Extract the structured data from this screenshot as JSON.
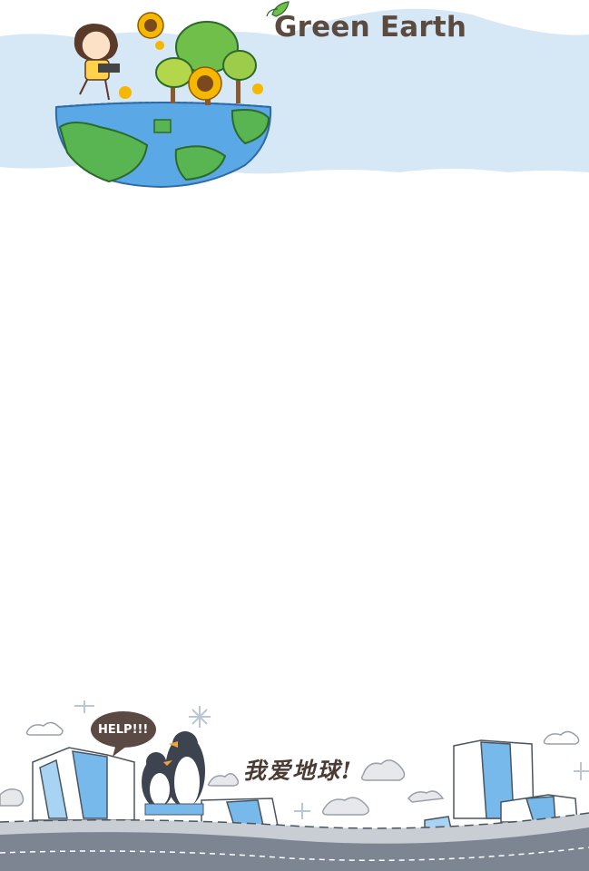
{
  "header": {
    "title": "Green Earth"
  },
  "footer": {
    "slogan": "我爱地球!",
    "speech_bubble": "HELP!!!"
  },
  "colors": {
    "sky_band": "#d6e7f5",
    "title_text": "#5b4a3f",
    "earth_water": "#5aa9e6",
    "earth_land": "#58b552",
    "ice_blue": "#76b9ea",
    "road": "#7d8593",
    "bubble": "#5a4a43"
  },
  "icons": [
    "girl-illustration",
    "sunflower-icon",
    "tree-icon",
    "leaf-icon",
    "earth-icon",
    "penguin-icon",
    "cloud-icon",
    "snowflake-icon",
    "glacier-icon"
  ]
}
